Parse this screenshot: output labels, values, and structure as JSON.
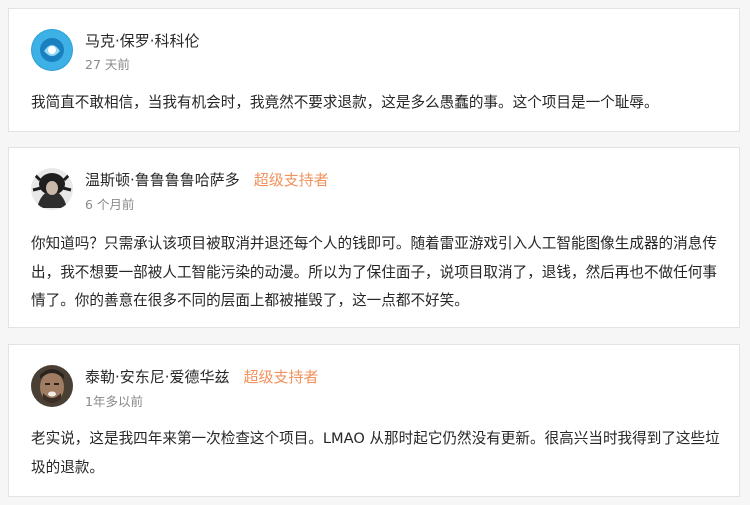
{
  "comments": [
    {
      "author": "马克·保罗·科科伦",
      "badge": "",
      "time": "27 天前",
      "text": "我简直不敢相信，当我有机会时，我竟然不要求退款，这是多么愚蠢的事。这个项目是一个耻辱。",
      "avatar_color": "#2a9fd8"
    },
    {
      "author": "温斯顿·鲁鲁鲁鲁哈萨多",
      "badge": "超级支持者",
      "time": "6 个月前",
      "text": "你知道吗？只需承认该项目被取消并退还每个人的钱即可。随着雷亚游戏引入人工智能图像生成器的消息传出，我不想要一部被人工智能污染的动漫。所以为了保住面子，说项目取消了，退钱，然后再也不做任何事情了。你的善意在很多不同的层面上都被摧毁了，这一点都不好笑。",
      "avatar_color": "#3a3a3a"
    },
    {
      "author": "泰勒·安东尼·爱德华兹",
      "badge": "超级支持者",
      "time": "1年多以前",
      "text": "老实说，这是我四年来第一次检查这个项目。LMAO 从那时起它仍然没有更新。很高兴当时我得到了这些垃圾的退款。",
      "avatar_color": "#5a4a3a"
    }
  ],
  "colors": {
    "badge": "#f0925e",
    "time": "#8a8a8a",
    "text": "#262626"
  }
}
